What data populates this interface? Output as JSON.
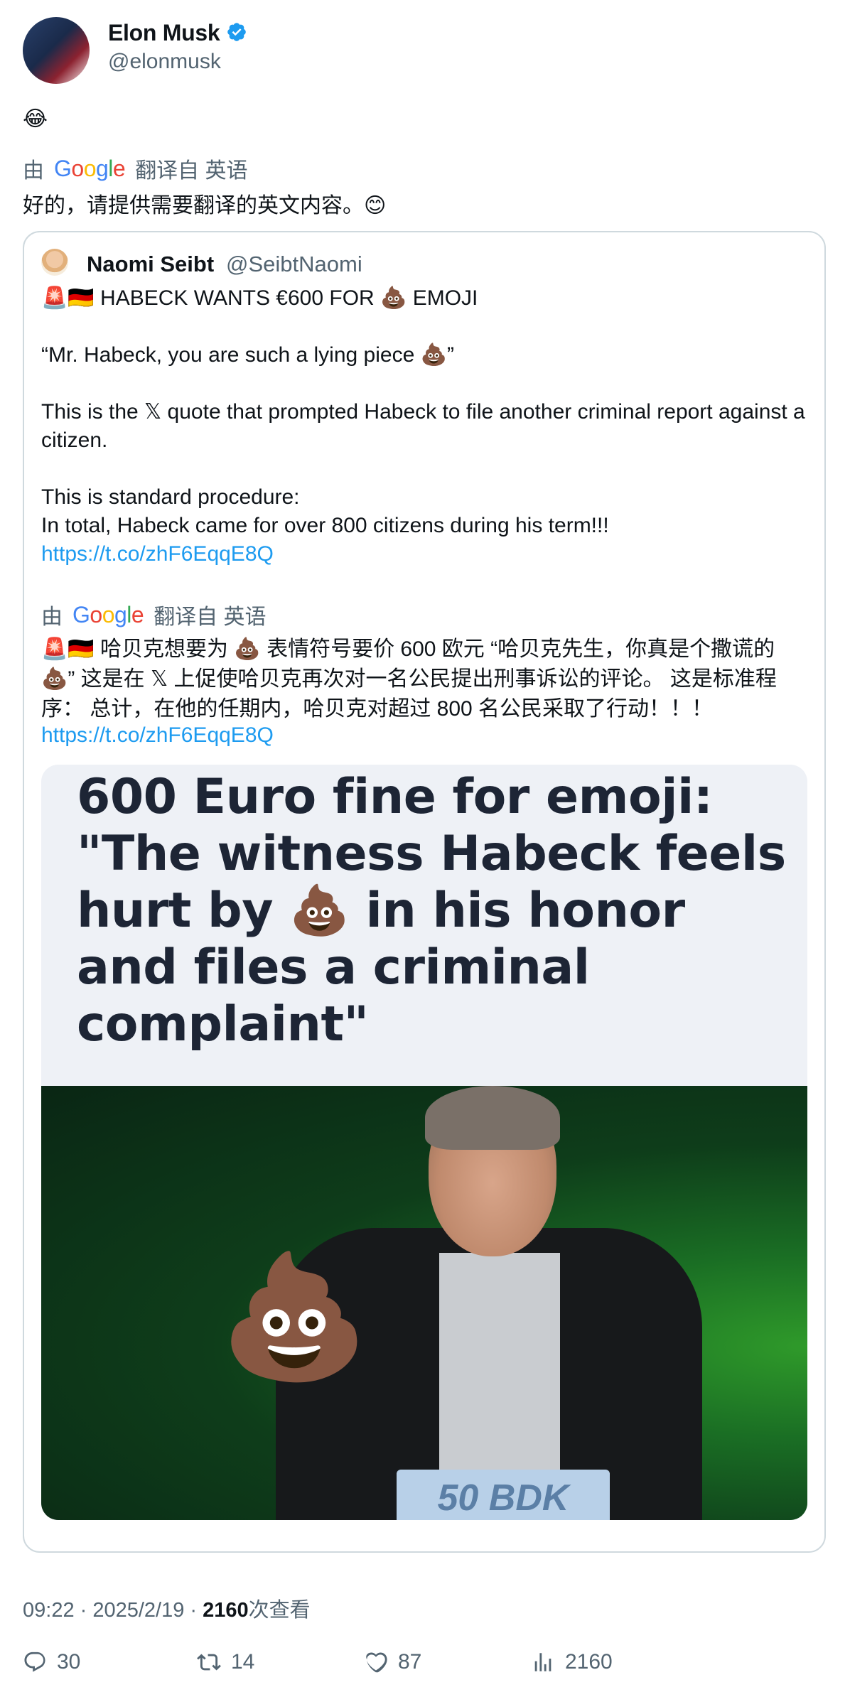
{
  "author": {
    "name": "Elon Musk",
    "handle": "@elonmusk",
    "verified": true
  },
  "tweet": {
    "text": "😂",
    "translated_by_prefix": "由",
    "translated_by_brand": "Google",
    "translated_from": "翻译自 英语",
    "translation": "好的，请提供需要翻译的英文内容。😊"
  },
  "quote": {
    "name": "Naomi Seibt",
    "handle": "@SeibtNaomi",
    "line1": "🚨🇩🇪 HABECK WANTS €600 FOR 💩 EMOJI",
    "line2": "“Mr. Habeck, you are such a lying piece 💩”",
    "line3": "This is the 𝕏 quote that prompted Habeck to file another criminal report against a citizen.",
    "line4": "This is standard procedure:",
    "line5": "In total, Habeck came for over 800 citizens during his term!!!",
    "link": "https://t.co/zhF6EqqE8Q",
    "translated_by_prefix": "由",
    "translated_by_brand": "Google",
    "translated_from": "翻译自 英语",
    "translation": "🚨🇩🇪 哈贝克想要为 💩 表情符号要价 600 欧元 “哈贝克先生，你真是个撒谎的 💩” 这是在 𝕏 上促使哈贝克再次对一名公民提出刑事诉讼的评论。 这是标准程序： 总计，在他的任期内，哈贝克对超过 800 名公民采取了行动！！！",
    "translation_link": "https://t.co/zhF6EqqE8Q",
    "media": {
      "headline": "600 Euro fine for emoji: \"The witness Habeck feels hurt by 💩 in his honor and files a criminal complaint\"",
      "podium_text": "50 BDK"
    }
  },
  "meta": {
    "time_date": "09:22 · 2025/2/19 · ",
    "views_count": "2160",
    "views_label": "次查看"
  },
  "actions": {
    "replies": "30",
    "reposts": "14",
    "likes": "87",
    "views": "2160"
  }
}
